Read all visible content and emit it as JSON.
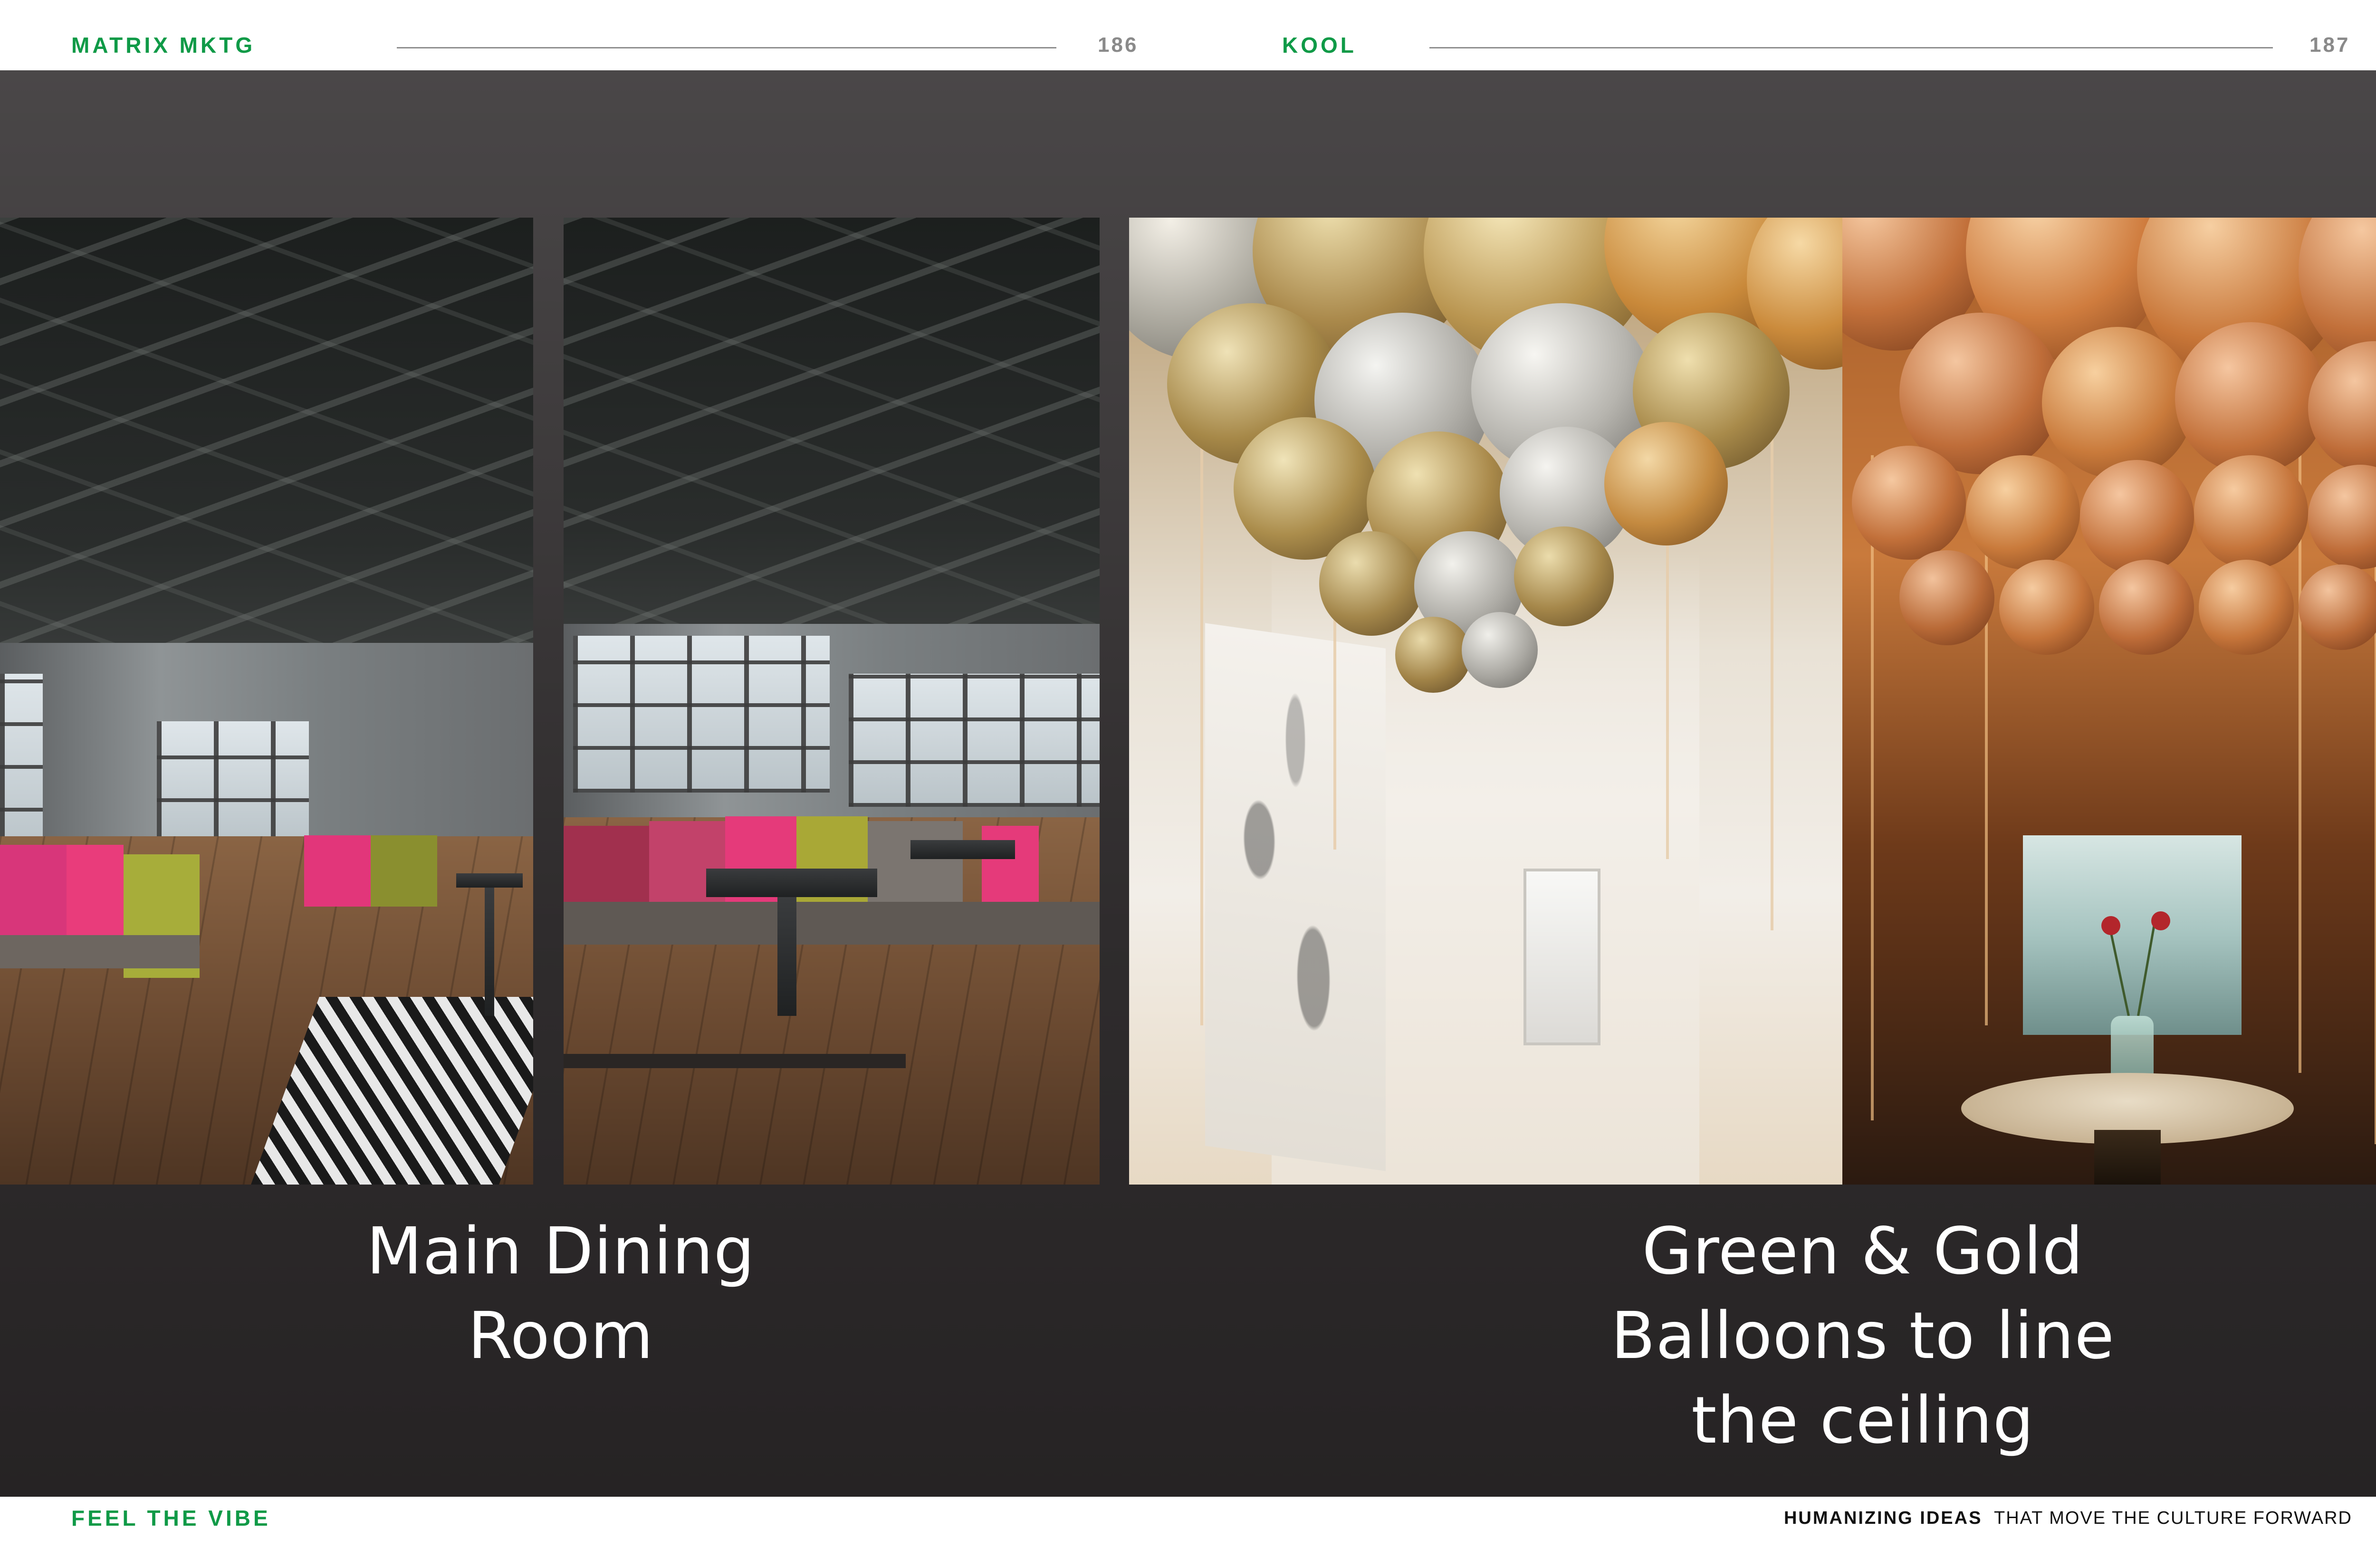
{
  "header": {
    "left_brand": "MATRIX MKTG",
    "left_page": "186",
    "right_brand": "KOOL",
    "right_page": "187"
  },
  "captions": {
    "dining": "Main Dining Room",
    "balloons_line1": "Green & Gold",
    "balloons_line2": "Balloons to line",
    "balloons_line3": "the ceiling"
  },
  "footer": {
    "left": "FEEL THE VIBE",
    "right_bold": "HUMANIZING IDEAS",
    "right_regular": "THAT MOVE THE CULTURE FORWARD"
  },
  "colors": {
    "brand_green": "#0f9a47",
    "page_number": "#8a8a8a",
    "panel_dark": "#2f2c2d",
    "caption_text": "#ffffff"
  }
}
